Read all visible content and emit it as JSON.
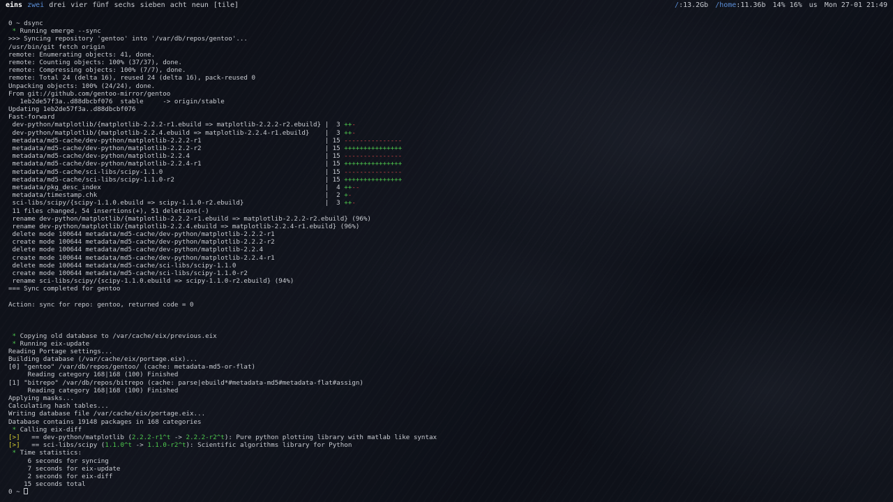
{
  "topbar": {
    "workspaces": [
      {
        "label": "eins",
        "state": "active"
      },
      {
        "label": "zwei",
        "state": "accent"
      },
      {
        "label": "drei",
        "state": "normal"
      },
      {
        "label": "vier",
        "state": "normal"
      },
      {
        "label": "fünf",
        "state": "normal"
      },
      {
        "label": "sechs",
        "state": "normal"
      },
      {
        "label": "sieben",
        "state": "normal"
      },
      {
        "label": "acht",
        "state": "normal"
      },
      {
        "label": "neun",
        "state": "normal"
      }
    ],
    "layout": "[tile]",
    "status": {
      "root_label": "/",
      "root_value": ":13.2Gb",
      "home_label": "/home",
      "home_value": ":11.36b",
      "cpu": "14% 16%",
      "keyboard": "us",
      "datetime": "Mon 27-01 21:49"
    }
  },
  "terminal": {
    "lines": [
      [
        {
          "t": "0 ~ dsync"
        }
      ],
      [
        {
          "t": " * ",
          "c": "star"
        },
        {
          "t": "Running emerge --sync"
        }
      ],
      [
        {
          "t": ">>> Syncing repository 'gentoo' into '/var/db/repos/gentoo'..."
        }
      ],
      [
        {
          "t": "/usr/bin/git fetch origin"
        }
      ],
      [
        {
          "t": "remote: Enumerating objects: 41, done."
        }
      ],
      [
        {
          "t": "remote: Counting objects: 100% (37/37), done."
        }
      ],
      [
        {
          "t": "remote: Compressing objects: 100% (7/7), done."
        }
      ],
      [
        {
          "t": "remote: Total 24 (delta 16), reused 24 (delta 16), pack-reused 0"
        }
      ],
      [
        {
          "t": "Unpacking objects: 100% (24/24), done."
        }
      ],
      [
        {
          "t": "From git://github.com/gentoo-mirror/gentoo"
        }
      ],
      [
        {
          "t": "   1eb2de57f3a..d88dbcbf076  stable     -> origin/stable"
        }
      ],
      [
        {
          "t": "Updating 1eb2de57f3a..d88dbcbf076"
        }
      ],
      [
        {
          "t": "Fast-forward"
        }
      ],
      [
        {
          "t": " dev-python/matplotlib/{matplotlib-2.2.2-r1.ebuild => matplotlib-2.2.2-r2.ebuild} |  3 "
        },
        {
          "t": "++",
          "c": "green"
        },
        {
          "t": "-",
          "c": "red"
        }
      ],
      [
        {
          "t": " dev-python/matplotlib/{matplotlib-2.2.4.ebuild => matplotlib-2.2.4-r1.ebuild}    |  3 "
        },
        {
          "t": "++",
          "c": "green"
        },
        {
          "t": "-",
          "c": "red"
        }
      ],
      [
        {
          "t": " metadata/md5-cache/dev-python/matplotlib-2.2.2-r1                                | 15 "
        },
        {
          "t": "---------------",
          "c": "red"
        }
      ],
      [
        {
          "t": " metadata/md5-cache/dev-python/matplotlib-2.2.2-r2                                | 15 "
        },
        {
          "t": "+++++++++++++++",
          "c": "green"
        }
      ],
      [
        {
          "t": " metadata/md5-cache/dev-python/matplotlib-2.2.4                                   | 15 "
        },
        {
          "t": "---------------",
          "c": "red"
        }
      ],
      [
        {
          "t": " metadata/md5-cache/dev-python/matplotlib-2.2.4-r1                                | 15 "
        },
        {
          "t": "+++++++++++++++",
          "c": "green"
        }
      ],
      [
        {
          "t": " metadata/md5-cache/sci-libs/scipy-1.1.0                                          | 15 "
        },
        {
          "t": "---------------",
          "c": "red"
        }
      ],
      [
        {
          "t": " metadata/md5-cache/sci-libs/scipy-1.1.0-r2                                       | 15 "
        },
        {
          "t": "+++++++++++++++",
          "c": "green"
        }
      ],
      [
        {
          "t": " metadata/pkg_desc_index                                                          |  4 "
        },
        {
          "t": "++",
          "c": "green"
        },
        {
          "t": "--",
          "c": "red"
        }
      ],
      [
        {
          "t": " metadata/timestamp.chk                                                           |  2 "
        },
        {
          "t": "+",
          "c": "green"
        },
        {
          "t": "-",
          "c": "red"
        }
      ],
      [
        {
          "t": " sci-libs/scipy/{scipy-1.1.0.ebuild => scipy-1.1.0-r2.ebuild}                     |  3 "
        },
        {
          "t": "++",
          "c": "green"
        },
        {
          "t": "-",
          "c": "red"
        }
      ],
      [
        {
          "t": " 11 files changed, 54 insertions(+), 51 deletions(-)"
        }
      ],
      [
        {
          "t": " rename dev-python/matplotlib/{matplotlib-2.2.2-r1.ebuild => matplotlib-2.2.2-r2.ebuild} (96%)"
        }
      ],
      [
        {
          "t": " rename dev-python/matplotlib/{matplotlib-2.2.4.ebuild => matplotlib-2.2.4-r1.ebuild} (96%)"
        }
      ],
      [
        {
          "t": " delete mode 100644 metadata/md5-cache/dev-python/matplotlib-2.2.2-r1"
        }
      ],
      [
        {
          "t": " create mode 100644 metadata/md5-cache/dev-python/matplotlib-2.2.2-r2"
        }
      ],
      [
        {
          "t": " delete mode 100644 metadata/md5-cache/dev-python/matplotlib-2.2.4"
        }
      ],
      [
        {
          "t": " create mode 100644 metadata/md5-cache/dev-python/matplotlib-2.2.4-r1"
        }
      ],
      [
        {
          "t": " delete mode 100644 metadata/md5-cache/sci-libs/scipy-1.1.0"
        }
      ],
      [
        {
          "t": " create mode 100644 metadata/md5-cache/sci-libs/scipy-1.1.0-r2"
        }
      ],
      [
        {
          "t": " rename sci-libs/scipy/{scipy-1.1.0.ebuild => scipy-1.1.0-r2.ebuild} (94%)"
        }
      ],
      [
        {
          "t": "=== Sync completed for gentoo"
        }
      ],
      [
        {
          "t": ""
        }
      ],
      [
        {
          "t": "Action: sync for repo: gentoo, returned code = 0"
        }
      ],
      [
        {
          "t": ""
        }
      ],
      [
        {
          "t": ""
        }
      ],
      [
        {
          "t": ""
        }
      ],
      [
        {
          "t": " * ",
          "c": "star"
        },
        {
          "t": "Copying old database to /var/cache/eix/previous.eix"
        }
      ],
      [
        {
          "t": " * ",
          "c": "star"
        },
        {
          "t": "Running eix-update"
        }
      ],
      [
        {
          "t": "Reading Portage settings..."
        }
      ],
      [
        {
          "t": "Building database (/var/cache/eix/portage.eix)..."
        }
      ],
      [
        {
          "t": "[0] \"gentoo\" /var/db/repos/gentoo/ (cache: metadata-md5-or-flat)"
        }
      ],
      [
        {
          "t": "     Reading category 168|168 (100) Finished"
        }
      ],
      [
        {
          "t": "[1] \"bitrepo\" /var/db/repos/bitrepo (cache: parse|ebuild*#metadata-md5#metadata-flat#assign)"
        }
      ],
      [
        {
          "t": "     Reading category 168|168 (100) Finished"
        }
      ],
      [
        {
          "t": "Applying masks..."
        }
      ],
      [
        {
          "t": "Calculating hash tables..."
        }
      ],
      [
        {
          "t": "Writing database file /var/cache/eix/portage.eix..."
        }
      ],
      [
        {
          "t": "Database contains 19148 packages in 168 categories"
        }
      ],
      [
        {
          "t": " * ",
          "c": "star"
        },
        {
          "t": "Calling eix-diff"
        }
      ],
      [
        {
          "t": "[>]",
          "c": "bracket"
        },
        {
          "t": "   == dev-python/matplotlib ("
        },
        {
          "t": "2.2.2-r1^t",
          "c": "ver-old"
        },
        {
          "t": " -> "
        },
        {
          "t": "2.2.2-r2^t",
          "c": "ver-new"
        },
        {
          "t": "): Pure python plotting library with matlab like syntax"
        }
      ],
      [
        {
          "t": "[>]",
          "c": "bracket"
        },
        {
          "t": "   == sci-libs/scipy ("
        },
        {
          "t": "1.1.0^t",
          "c": "ver-old"
        },
        {
          "t": " -> "
        },
        {
          "t": "1.1.0-r2^t",
          "c": "ver-new"
        },
        {
          "t": "): Scientific algorithms library for Python"
        }
      ],
      [
        {
          "t": " * ",
          "c": "star"
        },
        {
          "t": "Time statistics:"
        }
      ],
      [
        {
          "t": "     6 seconds for syncing"
        }
      ],
      [
        {
          "t": "     7 seconds for eix-update"
        }
      ],
      [
        {
          "t": "     2 seconds for eix-diff"
        }
      ],
      [
        {
          "t": "    15 seconds total"
        }
      ]
    ],
    "prompt": "0 ~ "
  }
}
